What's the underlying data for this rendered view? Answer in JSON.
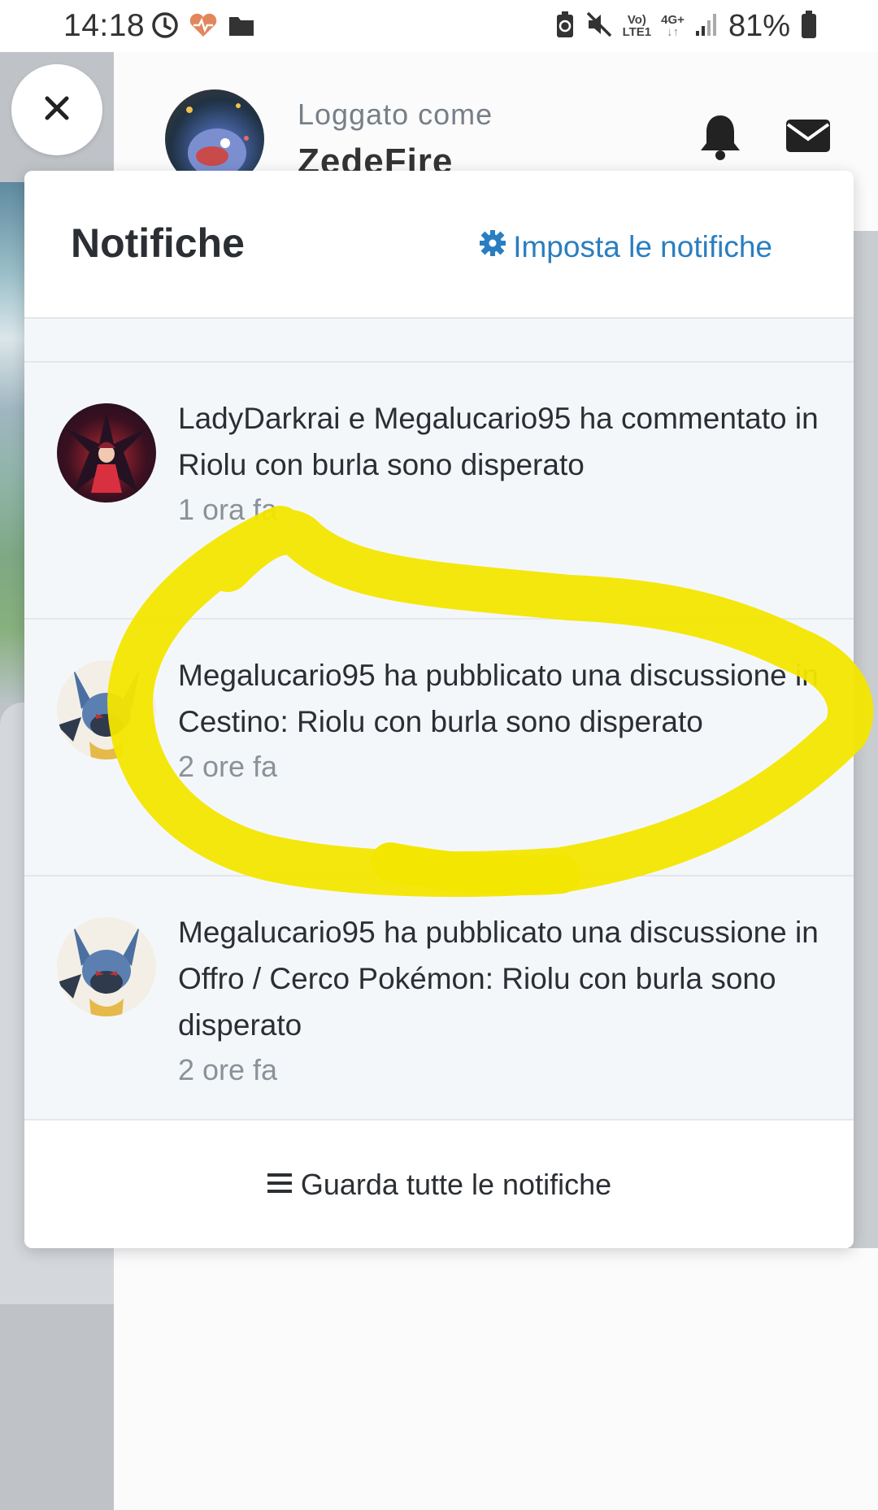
{
  "status_bar": {
    "time": "14:18",
    "network_top": "Vo)",
    "network_bottom": "LTE1",
    "net_type": "4G+",
    "battery_percent": "81%",
    "icons": [
      "alarm-icon",
      "health-icon",
      "folder-icon",
      "battery-saver-icon",
      "mute-icon",
      "volte-icon",
      "4g-icon",
      "signal-icon",
      "battery-icon"
    ]
  },
  "header": {
    "close_icon": "close-icon",
    "logged_label": "Loggato come",
    "username": "ZedeFire",
    "icons": [
      "bell-icon",
      "mail-icon"
    ]
  },
  "panel": {
    "title": "Notifiche",
    "settings_label": "Imposta le notifiche",
    "notifications": [
      {
        "text": "LadyDarkrai e Megalucario95 ha commentato in Riolu con burla sono disperato",
        "time": "1 ora fa"
      },
      {
        "text": "Megalucario95 ha pubblicato una discussione in Cestino: Riolu con burla sono disperato",
        "time": "2 ore fa"
      },
      {
        "text": "Megalucario95 ha pubblicato una discussione in Offro / Cerco Pokémon: Riolu con burla sono disperato",
        "time": "2 ore fa"
      }
    ],
    "footer_label": "Guarda tutte le notifiche"
  },
  "colors": {
    "accent": "#2a7ec0",
    "annotation": "#f3e600",
    "notification_bg": "#f4f7fa"
  }
}
